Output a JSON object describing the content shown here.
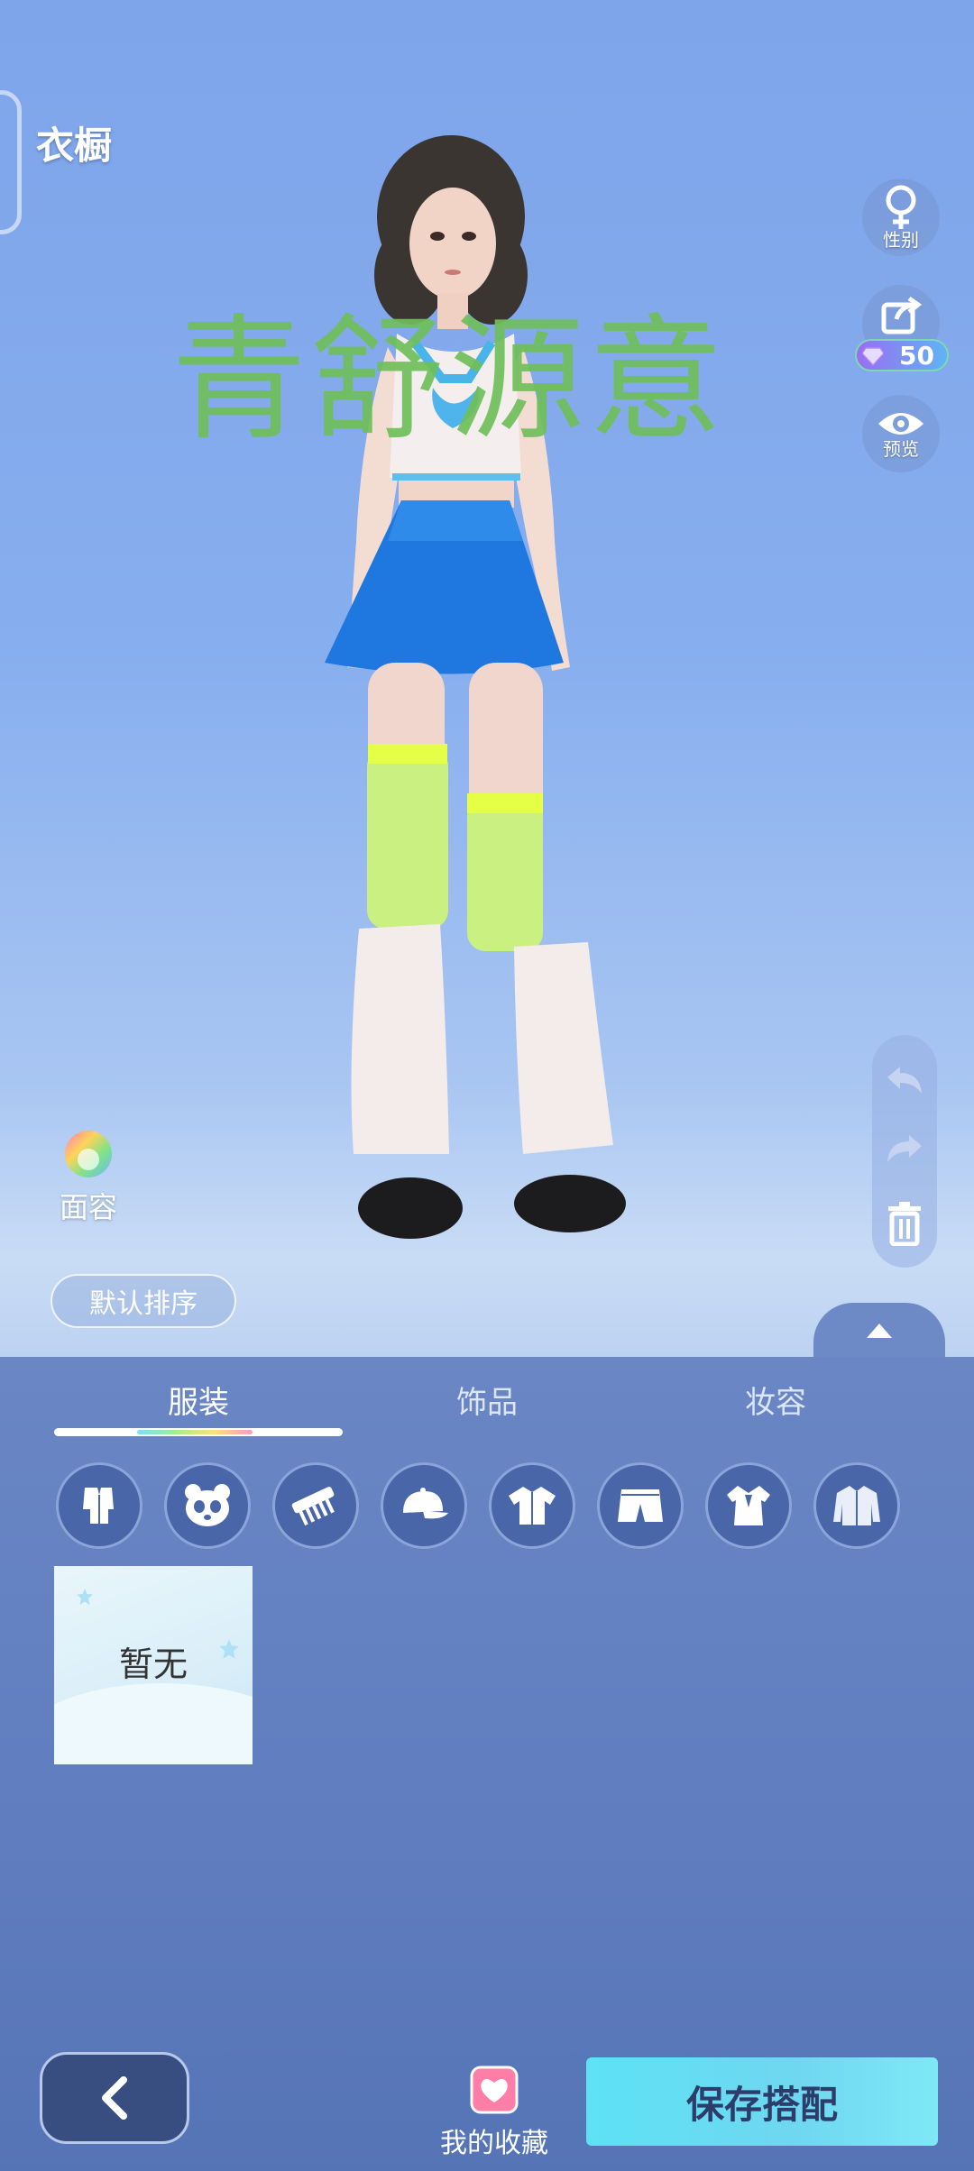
{
  "header": {
    "title": "衣橱"
  },
  "watermark": "青舒源意",
  "side": {
    "gender_label": "性别",
    "share_gems": "50",
    "preview_label": "预览"
  },
  "face": {
    "label": "面容"
  },
  "sort": {
    "label": "默认排序"
  },
  "tabs": [
    {
      "label": "服装",
      "active": true
    },
    {
      "label": "饰品",
      "active": false
    },
    {
      "label": "妆容",
      "active": false
    }
  ],
  "categories": [
    "suit-icon",
    "panda-icon",
    "comb-icon",
    "cap-icon",
    "shirt-icon",
    "shorts-icon",
    "dress-icon",
    "jacket-icon"
  ],
  "empty": {
    "label": "暂无"
  },
  "footer": {
    "favorites_label": "我的收藏",
    "save_label": "保存搭配"
  },
  "colors": {
    "panel": "#5f7dbf",
    "save": "#5de2f4",
    "watermark": "#6fbf5a"
  }
}
